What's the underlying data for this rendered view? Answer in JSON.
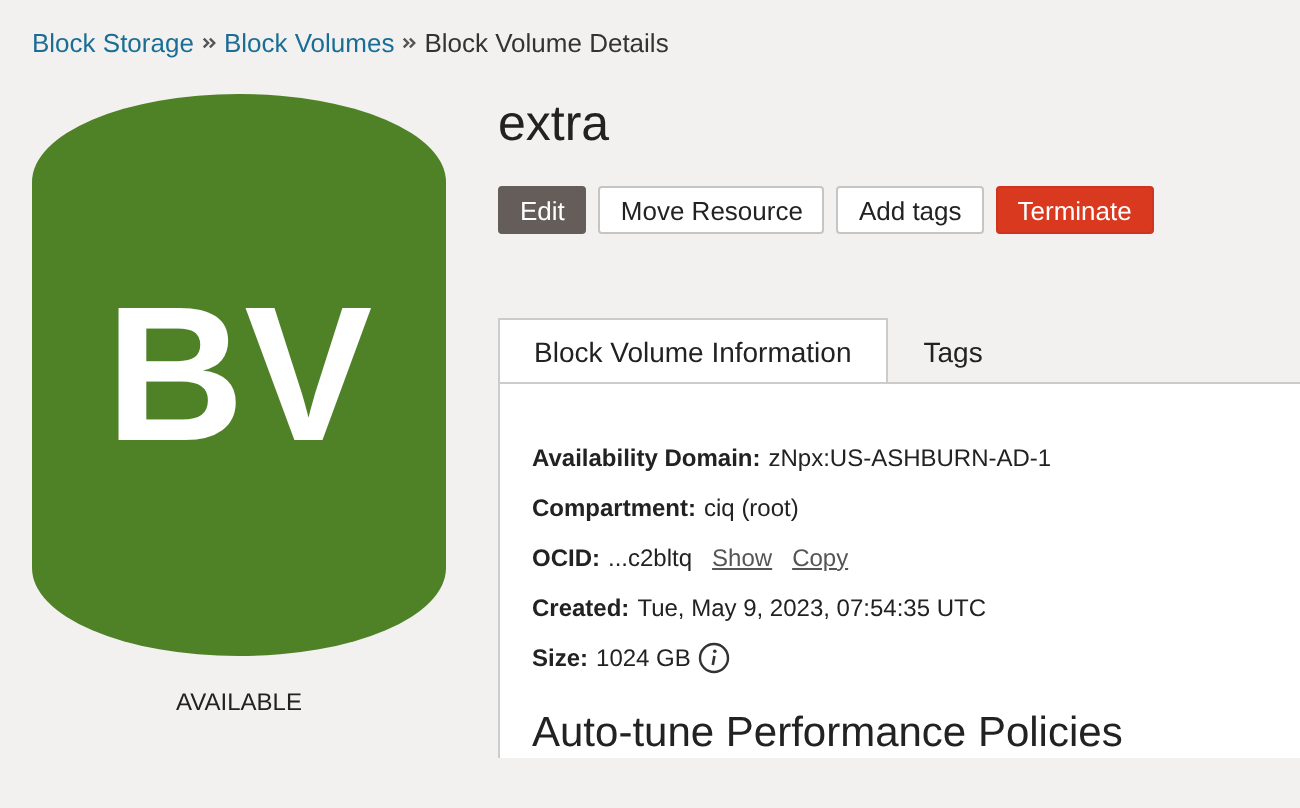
{
  "breadcrumbs": [
    {
      "label": "Block Storage",
      "kind": "link"
    },
    {
      "label": "Block Volumes",
      "kind": "link"
    },
    {
      "label": "Block Volume Details",
      "kind": "current"
    }
  ],
  "resource": {
    "initials": "BV",
    "status": "AVAILABLE",
    "color": "#4f8126"
  },
  "title": "extra",
  "actions": [
    {
      "label": "Edit",
      "kind": "primary"
    },
    {
      "label": "Move Resource",
      "kind": "default"
    },
    {
      "label": "Add tags",
      "kind": "default"
    },
    {
      "label": "Terminate",
      "kind": "danger"
    }
  ],
  "tabs": [
    {
      "label": "Block Volume Information",
      "selected": true
    },
    {
      "label": "Tags",
      "selected": false
    }
  ],
  "details": [
    {
      "label": "Availability Domain:",
      "value": "zNpx:US-ASHBURN-AD-1"
    },
    {
      "label": "Compartment:",
      "value": "ciq (root)"
    },
    {
      "label": "OCID:",
      "value": "...c2bltq",
      "links": [
        "Show",
        "Copy"
      ]
    },
    {
      "label": "Created:",
      "value": "Tue, May 9, 2023, 07:54:35 UTC"
    },
    {
      "label": "Size:",
      "value": "1024 GB",
      "info": true
    }
  ],
  "section_title": "Auto-tune Performance Policies"
}
